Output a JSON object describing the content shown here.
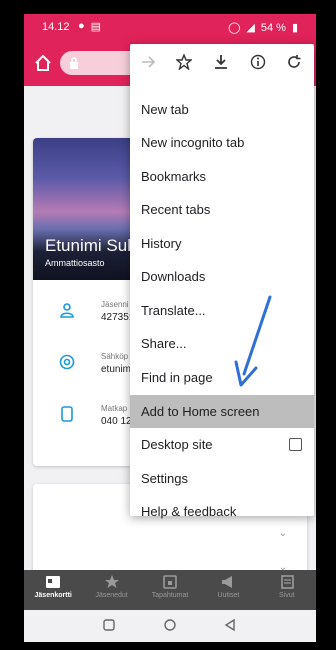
{
  "status_bar": {
    "time": "14.12",
    "battery": "54 %"
  },
  "menu": {
    "items": [
      {
        "label": "New tab"
      },
      {
        "label": "New incognito tab"
      },
      {
        "label": "Bookmarks"
      },
      {
        "label": "Recent tabs"
      },
      {
        "label": "History"
      },
      {
        "label": "Downloads"
      },
      {
        "label": "Translate..."
      },
      {
        "label": "Share..."
      },
      {
        "label": "Find in page"
      },
      {
        "label": "Add to Home screen"
      },
      {
        "label": "Desktop site"
      },
      {
        "label": "Settings"
      },
      {
        "label": "Help & feedback"
      }
    ]
  },
  "card": {
    "name": "Etunimi Suk",
    "department": "Ammattiosasto",
    "rows": [
      {
        "label": "Jäsenni",
        "value": "42735:"
      },
      {
        "label": "Sähköp",
        "value": "etunim"
      },
      {
        "label": "Matkap",
        "value": "040 12"
      }
    ]
  },
  "bottom_nav": {
    "items": [
      {
        "label": "Jäsenkortti"
      },
      {
        "label": "Jäsenedut"
      },
      {
        "label": "Tapahtumat"
      },
      {
        "label": "Uutiset"
      },
      {
        "label": "Sivut"
      }
    ]
  },
  "colors": {
    "brand": "#e0235a",
    "accent": "#1c9ad6",
    "highlight": "#bdbdbd"
  }
}
